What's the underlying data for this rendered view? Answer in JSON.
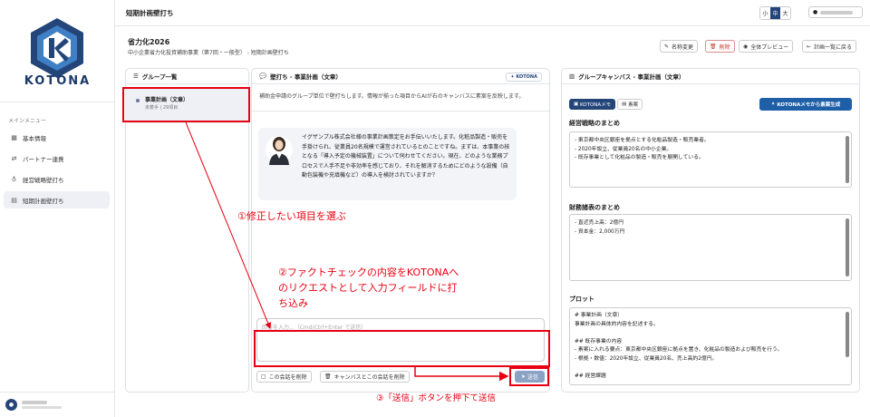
{
  "app": {
    "logo_text": "KOTONA",
    "brand_color": "#24457a",
    "accent_color": "#1f5fa8",
    "annotation_color": "#e60012"
  },
  "sidebar": {
    "menu_title": "メインメニュー",
    "items": [
      {
        "label": "基本情報",
        "icon": "building-icon"
      },
      {
        "label": "パートナー連携",
        "icon": "partner-icon"
      },
      {
        "label": "経営戦略壁打ち",
        "icon": "lightbulb-icon"
      },
      {
        "label": "短期計画壁打ち",
        "icon": "document-icon",
        "active": true
      }
    ]
  },
  "topbar": {
    "title": "短期計画壁打ち",
    "font_sizes": [
      "小",
      "中",
      "大"
    ],
    "selected_size": "中"
  },
  "project": {
    "title": "省力化2026",
    "subtitle": "中小企業省力化投資補助事業（第7回・一般型） - 短期計画壁打ち",
    "buttons": {
      "rename": "名称変更",
      "delete": "削除",
      "preview": "全体プレビュー",
      "back": "計画一覧に戻る"
    }
  },
  "group_panel": {
    "title": "グループ一覧",
    "items": [
      {
        "name": "事業計画（文章）",
        "meta": "未着手 | 29項目"
      }
    ]
  },
  "chat_panel": {
    "title": "壁打ち - 事業計画（文章）",
    "badge": "KOTONA",
    "description": "補助金申請のグループ単位で壁打ちします。情報が揃った項目からAIが右のキャンバスに素案を反映します。",
    "message": "イグザンプル株式会社様の事業計画策定をお手伝いいたします。化粧品製造・販売を手掛けられ、従業員20名規模で運営されているとのことですね。まずは、本事業の核となる「導入予定の機械装置」について伺わせてください。現在、どのような業務プロセスで人手不足や非効率を感じており、それを解消するためにどのような設備（自動包装機や充填機など）の導入を検討されていますか？",
    "input_placeholder": "回答を入力...（Cmd/Ctrl+Enter で送信）",
    "clear_button": "この会話を削除",
    "clear_all_button": "キャンバスとこの会話を削除",
    "send_button": "送信"
  },
  "canvas_panel": {
    "title": "グループキャンバス - 事業計画（文章）",
    "tabs": [
      "KOTONAメモ",
      "素案"
    ],
    "generate_button": "KOTONAメモから素案生成",
    "sections": [
      {
        "label": "経営戦略のまとめ",
        "text": "- 東京都中央区銀座を拠点とする化粧品製造・販売業者。\n- 2020年設立、従業員20名の中小企業。\n- 既存事業として化粧品の製造・販売を展開している。"
      },
      {
        "label": "財務諸表のまとめ",
        "text": "- 直近売上高：2億円\n- 資本金：2,000万円"
      },
      {
        "label": "プロット",
        "text": "# 事業計画（文章）\n事業計画の具体的内容を記述する。\n\n## 既存事業の内容\n- 素案に入れる要点：東京都中央区銀座に拠点を置き、化粧品の製造および販売を行う。\n- 根拠・数値：2020年設立、従業員20名、売上高約2億円。\n\n## 経営課題"
      }
    ]
  },
  "annotations": {
    "step1": "①修正したい項目を選ぶ",
    "step2_line1": "②ファクトチェックの内容をKOTONAへ",
    "step2_line2": "のリクエストとして入力フィールドに打",
    "step2_line3": "ち込み",
    "step3": "③「送信」ボタンを押下て送信"
  }
}
